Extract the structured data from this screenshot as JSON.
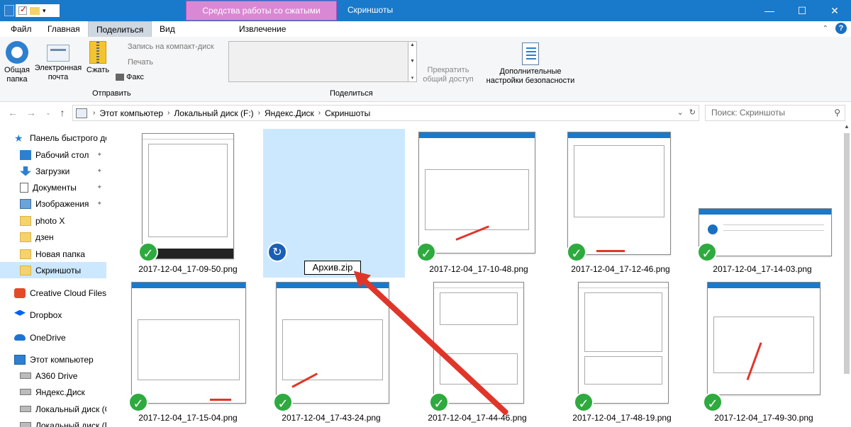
{
  "window": {
    "context_tab": "Средства работы со сжатыми папками",
    "title": "Скриншоты",
    "controls": [
      "—",
      "☐",
      "✕"
    ]
  },
  "ribbon_tabs": {
    "file": "Файл",
    "home": "Главная",
    "share": "Поделиться",
    "view": "Вид",
    "extract": "Извлечение"
  },
  "ribbon": {
    "share_label": "Общая\nпапка",
    "email_label": "Электронная\nпочта",
    "zip_label": "Сжать",
    "burn": "Запись на компакт-диск",
    "print": "Печать",
    "fax": "Факс",
    "send_group": "Отправить",
    "share_group": "Поделиться",
    "stop_sharing": "Прекратить\nобщий доступ",
    "advanced_security": "Дополнительные\nнастройки безопасности"
  },
  "address": {
    "crumbs": [
      "Этот компьютер",
      "Локальный диск (F:)",
      "Яндекс.Диск",
      "Скриншоты"
    ],
    "search_placeholder": "Поиск: Скриншоты"
  },
  "navpane": {
    "quick_access": "Панель быстрого до",
    "desktop": "Рабочий стол",
    "downloads": "Загрузки",
    "documents": "Документы",
    "images": "Изображения",
    "photo_x": "photo X",
    "dzen": "дзен",
    "new_folder": "Новая папка",
    "screenshots": "Скриншоты",
    "creative_cloud": "Creative Cloud Files",
    "dropbox": "Dropbox",
    "onedrive": "OneDrive",
    "this_pc": "Этот компьютер",
    "a360": "A360 Drive",
    "yadisk": "Яндекс.Диск",
    "local_c": "Локальный диск (С",
    "local_d": "Локальный диск (D"
  },
  "files": {
    "f1": "2017-12-04_17-09-50.png",
    "f2": "Архив.zip",
    "f3": "2017-12-04_17-10-48.png",
    "f4": "2017-12-04_17-12-46.png",
    "f5": "2017-12-04_17-14-03.png",
    "f6": "2017-12-04_17-15-04.png",
    "f7": "2017-12-04_17-43-24.png",
    "f8": "2017-12-04_17-44-46.png",
    "f9": "2017-12-04_17-48-19.png",
    "f10": "2017-12-04_17-49-30.png"
  },
  "colors": {
    "titlebar": "#1979ca",
    "context_tab": "#d989d4",
    "selection": "#cce8ff",
    "check_badge": "#2eaa3f",
    "annotation_arrow": "#e0362a"
  },
  "icons": {
    "check": "✓",
    "sync": "↻",
    "pin": "📌"
  }
}
